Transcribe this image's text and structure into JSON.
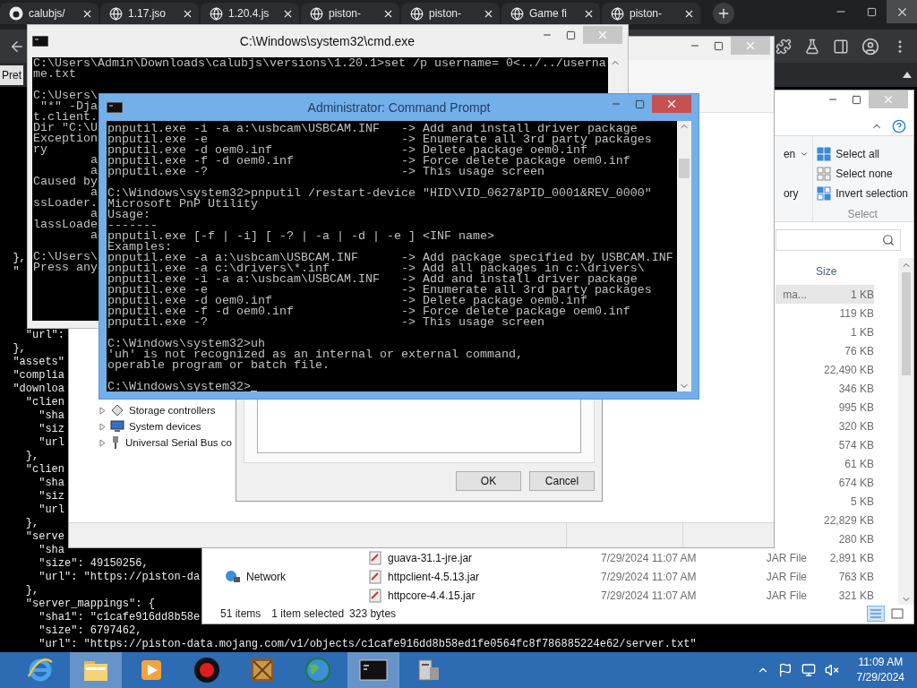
{
  "browser": {
    "tabs": [
      {
        "label": "calubjs/",
        "kind": "repo"
      },
      {
        "label": "1.17.jso",
        "kind": "web"
      },
      {
        "label": "1.20.4.js",
        "kind": "web"
      },
      {
        "label": "piston-",
        "kind": "web"
      },
      {
        "label": "piston-",
        "kind": "web"
      },
      {
        "label": "Game fi",
        "kind": "web"
      },
      {
        "label": "piston-",
        "kind": "web"
      }
    ],
    "pretty_print": "Pret",
    "json_upper": [
      "  },",
      "  \""
    ],
    "json_lower": [
      "    \"url\":",
      "  },",
      "  \"assets\"",
      "  \"complia",
      "  \"downloa",
      "    \"clien",
      "      \"sha",
      "      \"siz",
      "      \"url",
      "    },",
      "    \"clien",
      "      \"sha",
      "      \"siz",
      "      \"url",
      "    },",
      "    \"serve",
      "      \"sha",
      "      \"size\": 49150256,",
      "      \"url\": \"https://piston-da",
      "    },",
      "    \"server_mappings\": {",
      "      \"sha1\": \"c1cafe916dd8b58e",
      "      \"size\": 6797462,",
      "      \"url\": \"https://piston-data.mojang.com/v1/objects/c1cafe916dd8b58ed1fe0564fc8f786885224e62/server.txt\""
    ]
  },
  "explorer": {
    "ribbon": {
      "open_items": [
        "en",
        "ory"
      ],
      "select_items": [
        "Select all",
        "Select none",
        "Invert selection"
      ],
      "select_label": "Select"
    },
    "columns": {
      "size": "Size"
    },
    "rows": [
      {
        "type": "ma...",
        "size": "1 KB",
        "selected": true
      },
      {
        "size": "119 KB",
        "selected": false
      },
      {
        "size": "1 KB",
        "selected": false
      },
      {
        "size": "76 KB",
        "selected": false
      },
      {
        "size": "22,490 KB",
        "selected": false
      },
      {
        "size": "346 KB",
        "selected": false
      },
      {
        "size": "995 KB",
        "selected": false
      },
      {
        "size": "320 KB",
        "selected": false
      },
      {
        "size": "574 KB",
        "selected": false
      },
      {
        "size": "61 KB",
        "selected": false
      },
      {
        "size": "674 KB",
        "selected": false
      },
      {
        "size": "5 KB",
        "selected": false
      },
      {
        "size": "22,829 KB",
        "selected": false
      },
      {
        "size": "280 KB",
        "selected": false
      },
      {
        "name": "guava-31.1-jre.jar",
        "date": "7/29/2024 11:07 AM",
        "type": "JAR File",
        "size": "2,891 KB",
        "selected": false
      },
      {
        "name": "httpclient-4.5.13.jar",
        "date": "7/29/2024 11:07 AM",
        "type": "JAR File",
        "size": "763 KB",
        "selected": false
      },
      {
        "name": "httpcore-4.4.15.jar",
        "date": "7/29/2024 11:07 AM",
        "type": "JAR File",
        "size": "321 KB",
        "selected": false
      }
    ],
    "nav_items": [
      "Network"
    ],
    "status": {
      "count": "51 items",
      "selection": "1 item selected",
      "bytes": "323 bytes"
    }
  },
  "device_manager": {
    "tree_items": [
      {
        "label": "Storage controllers",
        "kind": "storage"
      },
      {
        "label": "System devices",
        "kind": "system"
      },
      {
        "label": "Universal Serial Bus co",
        "kind": "usb"
      }
    ],
    "dialog_buttons": [
      "OK",
      "Cancel"
    ]
  },
  "cmd_window": {
    "title": "C:\\Windows\\system32\\cmd.exe",
    "blocks": [
      [
        "C:\\Users\\Admin\\Downloads\\calubjs\\versions\\1.20.1>set /p username= 0<../../userna",
        "me.txt"
      ],
      [
        "C:\\Users\\",
        " \"*\" -Dja",
        "t.client.",
        "Dir \"C:\\U",
        "Exception",
        "ry",
        "        a",
        "        a",
        "Caused by",
        "        a",
        "ssLoader.",
        "        a",
        "lassLoade",
        "        a"
      ],
      [
        "C:\\Users\\",
        "Press any"
      ]
    ]
  },
  "admin_window": {
    "title": "Administrator: Command Prompt",
    "blocks": [
      [
        "pnputil.exe -i -a a:\\usbcam\\USBCAM.INF   -> Add and install driver package",
        "pnputil.exe -e                           -> Enumerate all 3rd party packages",
        "pnputil.exe -d oem0.inf                  -> Delete package oem0.inf",
        "pnputil.exe -f -d oem0.inf               -> Force delete package oem0.inf",
        "pnputil.exe -?                           -> This usage screen"
      ],
      [
        "C:\\Windows\\system32>pnputil /restart-device \"HID\\VID_0627&PID_0001&REV_0000\"",
        "Microsoft PnP Utility",
        "Usage:",
        "-------",
        "pnputil.exe [-f | -i] [ -? | -a | -d | -e ] <INF name>",
        "Examples:",
        "pnputil.exe -a a:\\usbcam\\USBCAM.INF      -> Add package specified by USBCAM.INF",
        "pnputil.exe -a c:\\drivers\\*.inf          -> Add all packages in c:\\drivers\\",
        "pnputil.exe -i -a a:\\usbcam\\USBCAM.INF   -> Add and install driver package",
        "pnputil.exe -e                           -> Enumerate all 3rd party packages",
        "pnputil.exe -d oem0.inf                  -> Delete package oem0.inf",
        "pnputil.exe -f -d oem0.inf               -> Force delete package oem0.inf",
        "pnputil.exe -?                           -> This usage screen"
      ],
      [
        "C:\\Windows\\system32>uh",
        "'uh' is not recognized as an internal or external command,",
        "operable program or batch file."
      ],
      [
        "C:\\Windows\\system32>"
      ]
    ]
  },
  "taskbar": {
    "apps": [
      {
        "kind": "browser",
        "active": false
      },
      {
        "kind": "files",
        "active": true
      },
      {
        "kind": "media",
        "active": false
      },
      {
        "kind": "recorder",
        "active": false
      },
      {
        "kind": "emulator",
        "active": false
      },
      {
        "kind": "globe",
        "active": false
      },
      {
        "kind": "console",
        "active": true
      },
      {
        "kind": "installer",
        "active": false
      }
    ],
    "time": "11:09 AM",
    "date": "7/29/2024"
  }
}
